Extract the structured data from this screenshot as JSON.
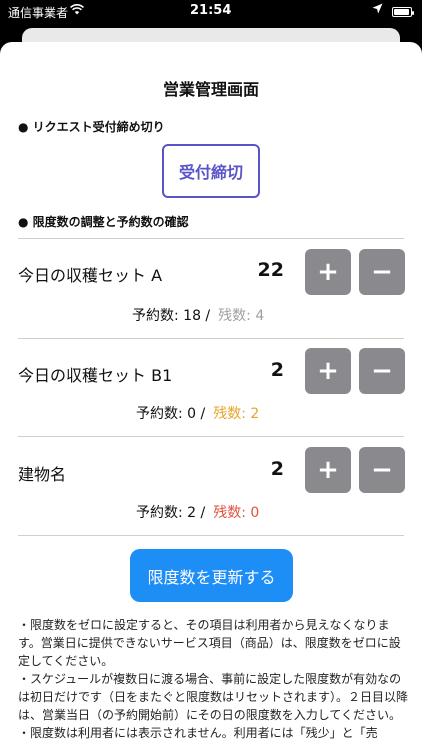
{
  "status_bar": {
    "carrier": "通信事業者",
    "time": "21:54"
  },
  "header": {
    "title": "営業管理画面"
  },
  "section_deadline": {
    "heading": "● リクエスト受付締め切り",
    "button_label": "受付締切"
  },
  "section_limits": {
    "heading": "● 限度数の調整と予約数の確認"
  },
  "items": [
    {
      "name": "今日の収穫セット A",
      "limit": "22",
      "reserved": "予約数: 18 /",
      "remaining": "残数: 4",
      "remaining_color": "#a0a0a0"
    },
    {
      "name": "今日の収穫セット B1",
      "limit": "2",
      "reserved": "予約数: 0 /",
      "remaining": "残数: 2",
      "remaining_color": "#e8a32b"
    },
    {
      "name": "建物名",
      "limit": "2",
      "reserved": "予約数: 2 /",
      "remaining": "残数: 0",
      "remaining_color": "#e0523f"
    }
  ],
  "stepper": {
    "plus": "+",
    "minus": "−"
  },
  "update_button_label": "限度数を更新する",
  "notes": [
    "・限度数をゼロに設定すると、その項目は利用者から見えなくなります。営業日に提供できないサービス項目（商品）は、限度数をゼロに設定してください。",
    "・スケジュールが複数日に渡る場合、事前に設定した限度数が有効なのは初日だけです（日をまたぐと限度数はリセットされます）。２日目以降は、営業当日（の予約開始前）にその日の限度数を入力してください。",
    "・限度数は利用者には表示されません。利用者には「残少」と「売"
  ]
}
